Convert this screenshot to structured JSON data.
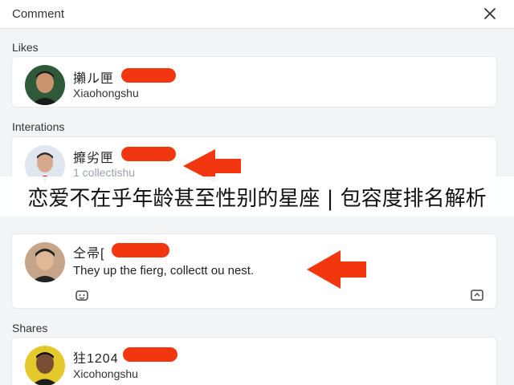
{
  "header": {
    "title": "Comment",
    "close_icon": "close-icon"
  },
  "likes": {
    "label": "Likes",
    "item": {
      "name": "攋ル匣",
      "subtitle": "Xiaohongshu"
    }
  },
  "interactions": {
    "label": "Interations",
    "item": {
      "name": "攠劣匣",
      "subtitle": "1 collectishu"
    }
  },
  "overlay": {
    "banner": "恋爱不在乎年龄甚至性别的星座 | 包容度排名解析"
  },
  "comment": {
    "name": "仝帚[",
    "text": "They up the fierg, collectt ou nest.",
    "left_icon": "emoji-icon",
    "right_icon": "share-box-icon"
  },
  "shares": {
    "label": "Shares",
    "item": {
      "name": "㹥1204",
      "subtitle": "Xicohongshu"
    }
  },
  "colors": {
    "redaction": "#f2360f",
    "arrow": "#f2360f"
  }
}
